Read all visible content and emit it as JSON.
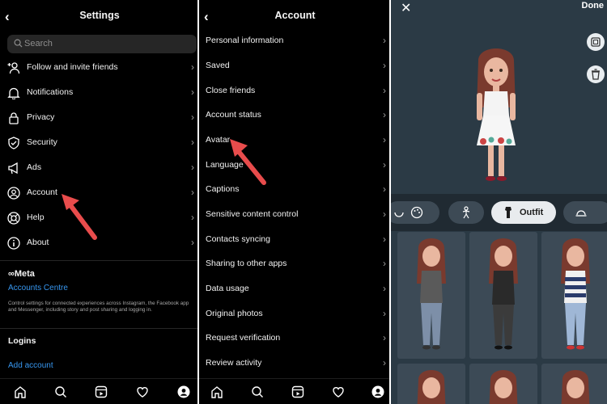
{
  "settings": {
    "title": "Settings",
    "search_placeholder": "Search",
    "items": [
      {
        "label": "Follow and invite friends",
        "icon": "add-person-icon"
      },
      {
        "label": "Notifications",
        "icon": "bell-icon"
      },
      {
        "label": "Privacy",
        "icon": "lock-icon"
      },
      {
        "label": "Security",
        "icon": "shield-icon"
      },
      {
        "label": "Ads",
        "icon": "megaphone-icon"
      },
      {
        "label": "Account",
        "icon": "person-circle-icon"
      },
      {
        "label": "Help",
        "icon": "lifebuoy-icon"
      },
      {
        "label": "About",
        "icon": "info-icon"
      }
    ],
    "meta_logo": "∞Meta",
    "accounts_centre": "Accounts Centre",
    "accounts_centre_desc": "Control settings for connected experiences across Instagram, the Facebook app and Messenger, including story and post sharing and logging in.",
    "logins_heading": "Logins",
    "add_account": "Add account"
  },
  "account": {
    "title": "Account",
    "items": [
      "Personal information",
      "Saved",
      "Close friends",
      "Account status",
      "Avatar",
      "Language",
      "Captions",
      "Sensitive content control",
      "Contacts syncing",
      "Sharing to other apps",
      "Data usage",
      "Original photos",
      "Request verification",
      "Review activity"
    ]
  },
  "avatar_editor": {
    "close_icon": "close-icon",
    "done_label": "Done",
    "active_tab": "Outfit",
    "tabs": [
      "body-icon",
      "palette-icon",
      "figure-icon",
      "outfit-icon",
      "headwear-icon"
    ]
  },
  "colors": {
    "link": "#3797f0",
    "arrow": "#e84c4c",
    "editor_bg": "#2b3a45",
    "card_bg": "#3c4a56"
  }
}
